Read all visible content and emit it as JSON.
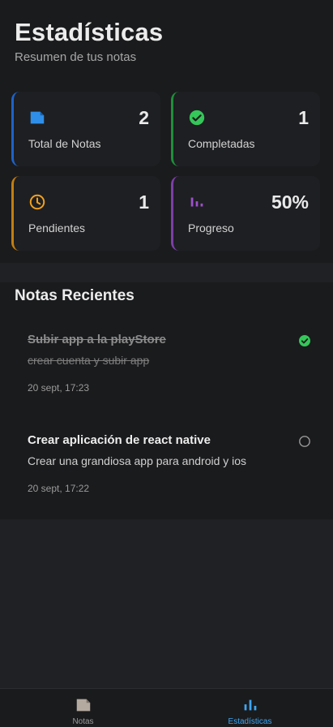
{
  "header": {
    "title": "Estadísticas",
    "subtitle": "Resumen de tus notas"
  },
  "stats": [
    {
      "label": "Total de Notas",
      "value": "2",
      "icon": "note-icon",
      "accent": "#2f8fe8"
    },
    {
      "label": "Completadas",
      "value": "1",
      "icon": "check-circle-icon",
      "accent": "#34c759"
    },
    {
      "label": "Pendientes",
      "value": "1",
      "icon": "clock-icon",
      "accent": "#f0a020"
    },
    {
      "label": "Progreso",
      "value": "50%",
      "icon": "bar-chart-icon",
      "accent": "#a04fd0"
    }
  ],
  "recent": {
    "title": "Notas Recientes",
    "notes": [
      {
        "title": "Subir app a la playStore",
        "description": "crear cuenta y subir app",
        "date": "20 sept, 17:23",
        "completed": true
      },
      {
        "title": "Crear aplicación de react native",
        "description": "Crear una grandiosa app para android y ios",
        "date": "20 sept, 17:22",
        "completed": false
      }
    ]
  },
  "nav": {
    "items": [
      {
        "label": "Notas",
        "icon": "note-icon",
        "active": false
      },
      {
        "label": "Estadísticas",
        "icon": "bar-chart-icon",
        "active": true
      }
    ]
  },
  "colors": {
    "active_tab": "#3ea6f2",
    "completed_check": "#34c759"
  }
}
